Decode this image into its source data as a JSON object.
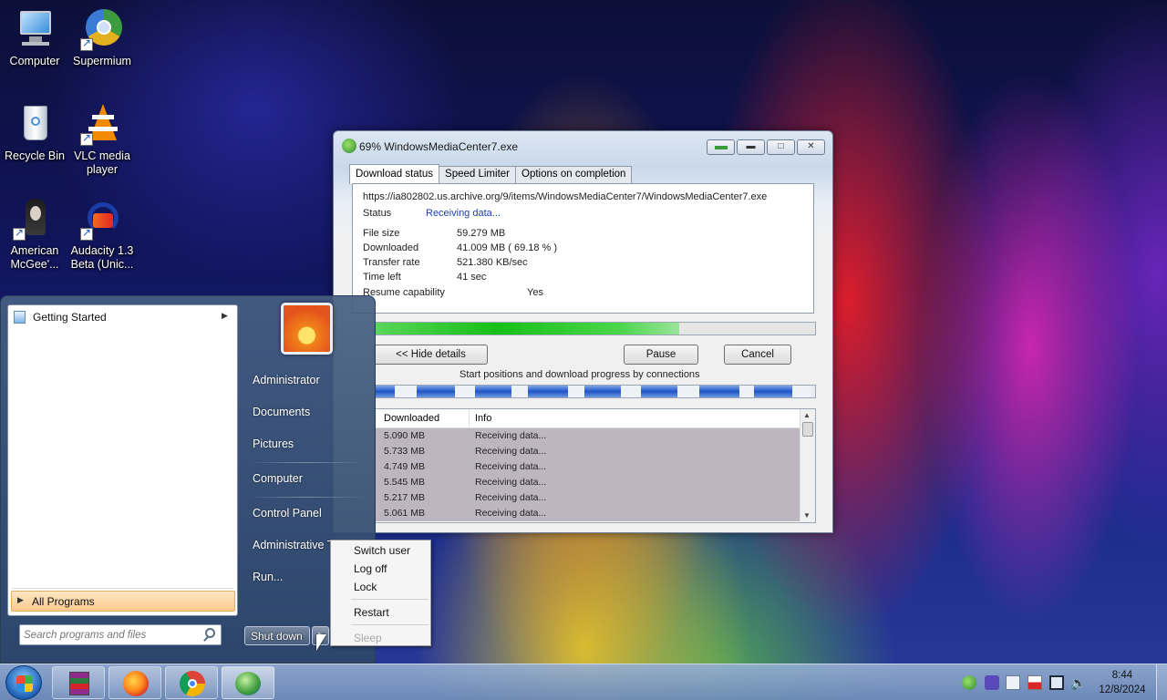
{
  "desktop": {
    "icons": [
      {
        "label": "Computer"
      },
      {
        "label": "Supermium"
      },
      {
        "label": "Recycle Bin"
      },
      {
        "label": "VLC media player"
      },
      {
        "label": "American McGee'..."
      },
      {
        "label": "Audacity 1.3 Beta (Unic..."
      }
    ]
  },
  "download_window": {
    "title": "69% WindowsMediaCenter7.exe",
    "tabs": [
      "Download status",
      "Speed Limiter",
      "Options on completion"
    ],
    "url": "https://ia802802.us.archive.org/9/items/WindowsMediaCenter7/WindowsMediaCenter7.exe",
    "status_label": "Status",
    "status_value": "Receiving data...",
    "file_size_label": "File size",
    "file_size_value": "59.279  MB",
    "downloaded_label": "Downloaded",
    "downloaded_value": "41.009  MB  ( 69.18 % )",
    "transfer_rate_label": "Transfer rate",
    "transfer_rate_value": "521.380  KB/sec",
    "time_left_label": "Time left",
    "time_left_value": "41 sec",
    "resume_label": "Resume capability",
    "resume_value": "Yes",
    "progress_fraction": 0.6918,
    "hide_details_button": "<< Hide details",
    "pause_button": "Pause",
    "cancel_button": "Cancel",
    "connections_caption": "Start positions and download progress by connections",
    "columns": [
      "Downloaded",
      "Info"
    ],
    "connections": [
      {
        "downloaded": "5.090  MB",
        "info": "Receiving data..."
      },
      {
        "downloaded": "5.733  MB",
        "info": "Receiving data..."
      },
      {
        "downloaded": "4.749  MB",
        "info": "Receiving data..."
      },
      {
        "downloaded": "5.545  MB",
        "info": "Receiving data..."
      },
      {
        "downloaded": "5.217  MB",
        "info": "Receiving data..."
      },
      {
        "downloaded": "5.061  MB",
        "info": "Receiving data..."
      }
    ]
  },
  "start_menu": {
    "pinned": [
      {
        "label": "Getting Started"
      }
    ],
    "all_programs": "All Programs",
    "search_placeholder": "Search programs and files",
    "right_items": [
      "Administrator",
      "Documents",
      "Pictures",
      "Computer",
      "Control Panel",
      "Administrative T",
      "Run..."
    ],
    "shutdown_label": "Shut down"
  },
  "shutdown_menu": {
    "items": [
      {
        "label": "Switch user",
        "enabled": true
      },
      {
        "label": "Log off",
        "enabled": true
      },
      {
        "label": "Lock",
        "enabled": true
      },
      {
        "label": "Restart",
        "enabled": true
      },
      {
        "label": "Sleep",
        "enabled": false
      }
    ]
  },
  "taskbar": {
    "clock_time": "8:44",
    "clock_date": "12/8/2024",
    "apps": [
      "winrar-icon",
      "firefox-icon",
      "chrome-icon",
      "idm-icon"
    ]
  },
  "colors": {
    "progress_green": "#16c016",
    "status_blue": "#1c3fb0",
    "segment_blue": "#2055c8"
  }
}
